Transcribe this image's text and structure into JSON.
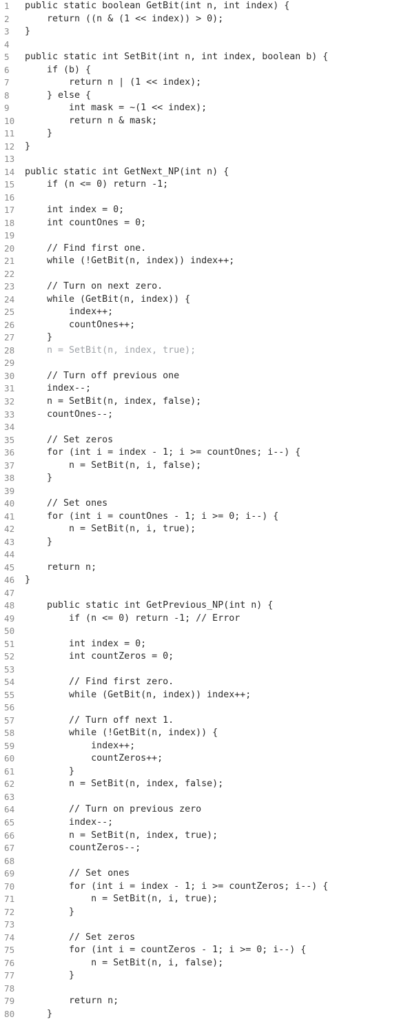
{
  "listing": {
    "language": "Java",
    "first_line_number": 1,
    "last_line_number": 80,
    "total_lines": 80,
    "colors": {
      "background": "#ffffff",
      "code_text": "#2b2b2b",
      "line_number": "#8a8a8a",
      "faded_text": "#9fa3a8"
    },
    "lines": [
      {
        "n": "1",
        "text": "public static boolean GetBit(int n, int index) {"
      },
      {
        "n": "2",
        "text": "    return ((n & (1 << index)) > 0);"
      },
      {
        "n": "3",
        "text": "}"
      },
      {
        "n": "4",
        "text": ""
      },
      {
        "n": "5",
        "text": "public static int SetBit(int n, int index, boolean b) {"
      },
      {
        "n": "6",
        "text": "    if (b) {"
      },
      {
        "n": "7",
        "text": "        return n | (1 << index);"
      },
      {
        "n": "8",
        "text": "    } else {"
      },
      {
        "n": "9",
        "text": "        int mask = ~(1 << index);"
      },
      {
        "n": "10",
        "text": "        return n & mask;"
      },
      {
        "n": "11",
        "text": "    }"
      },
      {
        "n": "12",
        "text": "}"
      },
      {
        "n": "13",
        "text": ""
      },
      {
        "n": "14",
        "text": "public static int GetNext_NP(int n) {"
      },
      {
        "n": "15",
        "text": "    if (n <= 0) return -1;"
      },
      {
        "n": "16",
        "text": ""
      },
      {
        "n": "17",
        "text": "    int index = 0;"
      },
      {
        "n": "18",
        "text": "    int countOnes = 0;"
      },
      {
        "n": "19",
        "text": ""
      },
      {
        "n": "20",
        "text": "    // Find first one."
      },
      {
        "n": "21",
        "text": "    while (!GetBit(n, index)) index++;"
      },
      {
        "n": "22",
        "text": ""
      },
      {
        "n": "23",
        "text": "    // Turn on next zero."
      },
      {
        "n": "24",
        "text": "    while (GetBit(n, index)) {"
      },
      {
        "n": "25",
        "text": "        index++;"
      },
      {
        "n": "26",
        "text": "        countOnes++;"
      },
      {
        "n": "27",
        "text": "    }"
      },
      {
        "n": "28",
        "text": "    n = SetBit(n, index, true);",
        "faded": true
      },
      {
        "n": "29",
        "text": ""
      },
      {
        "n": "30",
        "text": "    // Turn off previous one"
      },
      {
        "n": "31",
        "text": "    index--;"
      },
      {
        "n": "32",
        "text": "    n = SetBit(n, index, false);"
      },
      {
        "n": "33",
        "text": "    countOnes--;"
      },
      {
        "n": "34",
        "text": ""
      },
      {
        "n": "35",
        "text": "    // Set zeros"
      },
      {
        "n": "36",
        "text": "    for (int i = index - 1; i >= countOnes; i--) {"
      },
      {
        "n": "37",
        "text": "        n = SetBit(n, i, false);"
      },
      {
        "n": "38",
        "text": "    }"
      },
      {
        "n": "39",
        "text": ""
      },
      {
        "n": "40",
        "text": "    // Set ones"
      },
      {
        "n": "41",
        "text": "    for (int i = countOnes - 1; i >= 0; i--) {"
      },
      {
        "n": "42",
        "text": "        n = SetBit(n, i, true);"
      },
      {
        "n": "43",
        "text": "    }"
      },
      {
        "n": "44",
        "text": ""
      },
      {
        "n": "45",
        "text": "    return n;"
      },
      {
        "n": "46",
        "text": "}"
      },
      {
        "n": "47",
        "text": ""
      },
      {
        "n": "48",
        "text": "    public static int GetPrevious_NP(int n) {"
      },
      {
        "n": "49",
        "text": "        if (n <= 0) return -1; // Error"
      },
      {
        "n": "50",
        "text": ""
      },
      {
        "n": "51",
        "text": "        int index = 0;"
      },
      {
        "n": "52",
        "text": "        int countZeros = 0;"
      },
      {
        "n": "53",
        "text": ""
      },
      {
        "n": "54",
        "text": "        // Find first zero."
      },
      {
        "n": "55",
        "text": "        while (GetBit(n, index)) index++;"
      },
      {
        "n": "56",
        "text": ""
      },
      {
        "n": "57",
        "text": "        // Turn off next 1."
      },
      {
        "n": "58",
        "text": "        while (!GetBit(n, index)) {"
      },
      {
        "n": "59",
        "text": "            index++;"
      },
      {
        "n": "60",
        "text": "            countZeros++;"
      },
      {
        "n": "61",
        "text": "        }"
      },
      {
        "n": "62",
        "text": "        n = SetBit(n, index, false);"
      },
      {
        "n": "63",
        "text": ""
      },
      {
        "n": "64",
        "text": "        // Turn on previous zero"
      },
      {
        "n": "65",
        "text": "        index--;"
      },
      {
        "n": "66",
        "text": "        n = SetBit(n, index, true);"
      },
      {
        "n": "67",
        "text": "        countZeros--;"
      },
      {
        "n": "68",
        "text": ""
      },
      {
        "n": "69",
        "text": "        // Set ones"
      },
      {
        "n": "70",
        "text": "        for (int i = index - 1; i >= countZeros; i--) {"
      },
      {
        "n": "71",
        "text": "            n = SetBit(n, i, true);"
      },
      {
        "n": "72",
        "text": "        }"
      },
      {
        "n": "73",
        "text": ""
      },
      {
        "n": "74",
        "text": "        // Set zeros"
      },
      {
        "n": "75",
        "text": "        for (int i = countZeros - 1; i >= 0; i--) {"
      },
      {
        "n": "76",
        "text": "            n = SetBit(n, i, false);"
      },
      {
        "n": "77",
        "text": "        }"
      },
      {
        "n": "78",
        "text": ""
      },
      {
        "n": "79",
        "text": "        return n;"
      },
      {
        "n": "80",
        "text": "    }"
      }
    ]
  }
}
